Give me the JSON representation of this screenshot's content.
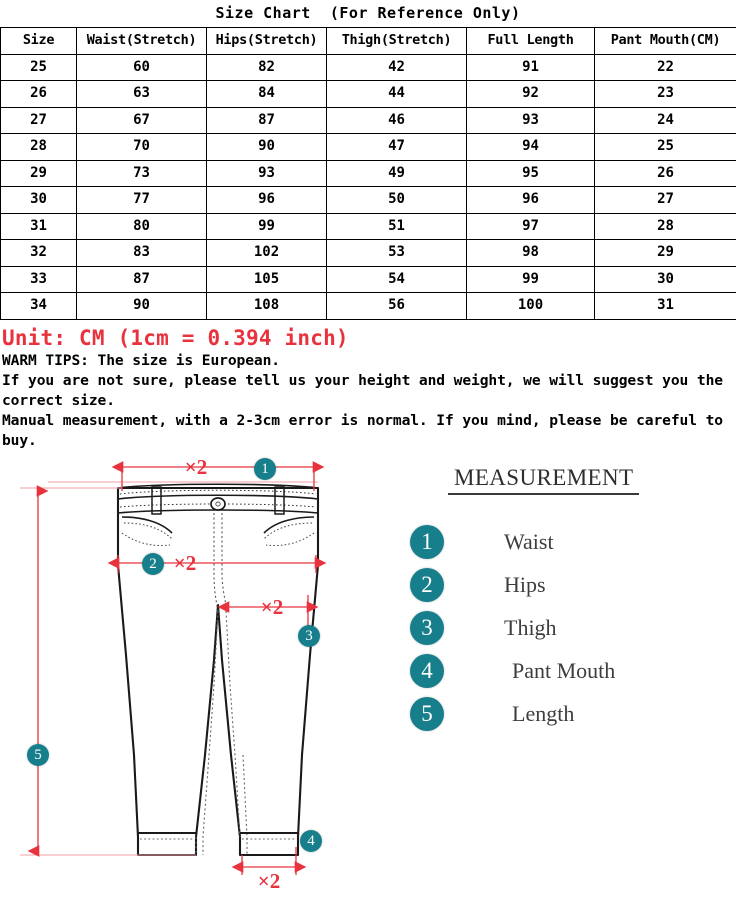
{
  "title": "Size Chart  (For Reference Only)",
  "table": {
    "headers": [
      "Size",
      "Waist(Stretch)",
      "Hips(Stretch)",
      "Thigh(Stretch)",
      "Full Length",
      "Pant Mouth(CM)"
    ],
    "rows": [
      [
        "25",
        "60",
        "82",
        "42",
        "91",
        "22"
      ],
      [
        "26",
        "63",
        "84",
        "44",
        "92",
        "23"
      ],
      [
        "27",
        "67",
        "87",
        "46",
        "93",
        "24"
      ],
      [
        "28",
        "70",
        "90",
        "47",
        "94",
        "25"
      ],
      [
        "29",
        "73",
        "93",
        "49",
        "95",
        "26"
      ],
      [
        "30",
        "77",
        "96",
        "50",
        "96",
        "27"
      ],
      [
        "31",
        "80",
        "99",
        "51",
        "97",
        "28"
      ],
      [
        "32",
        "83",
        "102",
        "53",
        "98",
        "29"
      ],
      [
        "33",
        "87",
        "105",
        "54",
        "99",
        "30"
      ],
      [
        "34",
        "90",
        "108",
        "56",
        "100",
        "31"
      ]
    ]
  },
  "notes": {
    "unit": "Unit: CM (1cm = 0.394 inch)",
    "line1": "WARM TIPS: The size is European.",
    "line2": "If you are not sure, please tell us your height and weight, we will suggest you the correct size.",
    "line3": "Manual measurement, with a 2-3cm error is normal. If you mind, please be careful to buy."
  },
  "legend": {
    "title": "MEASUREMENT",
    "items": [
      {
        "num": "1",
        "label": "Waist"
      },
      {
        "num": "2",
        "label": "Hips"
      },
      {
        "num": "3",
        "label": "Thigh"
      },
      {
        "num": "4",
        "label": "Pant Mouth"
      },
      {
        "num": "5",
        "label": "Length"
      }
    ]
  },
  "diagram": {
    "multiplier": "×2",
    "marks": [
      {
        "num": "1",
        "measure": "Waist"
      },
      {
        "num": "2",
        "measure": "Hips"
      },
      {
        "num": "3",
        "measure": "Thigh"
      },
      {
        "num": "4",
        "measure": "Pant Mouth"
      },
      {
        "num": "5",
        "measure": "Length"
      }
    ]
  },
  "colors": {
    "accent_teal": "#177f8b",
    "accent_red": "#e8333f",
    "border": "#000000"
  }
}
